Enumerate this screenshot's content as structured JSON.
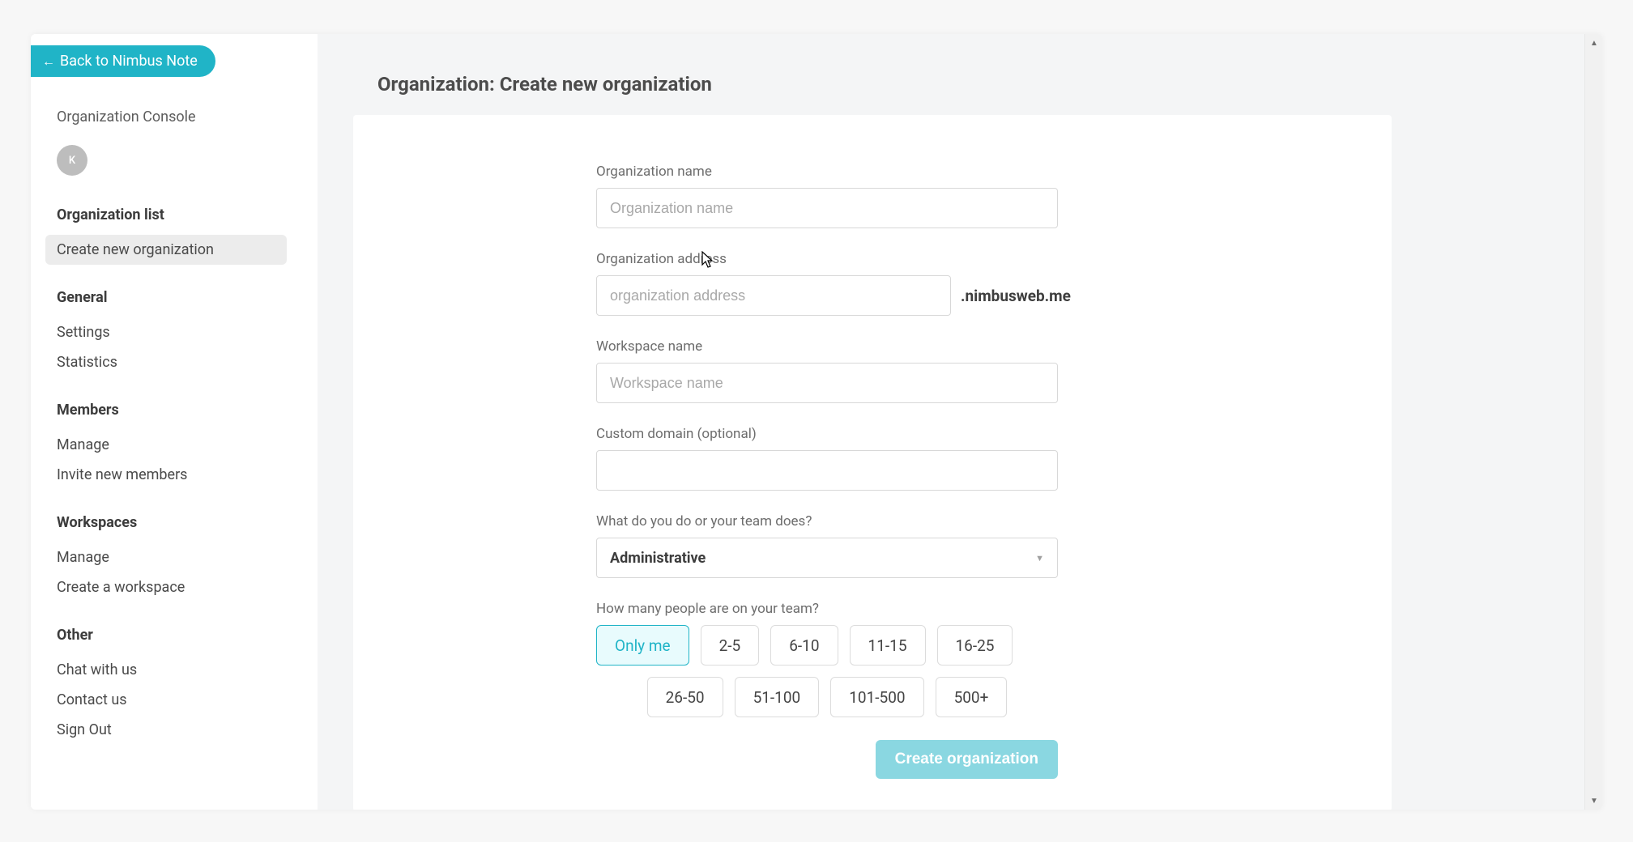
{
  "back_button_label": "Back to Nimbus Note",
  "sidebar": {
    "console_label": "Organization Console",
    "avatar_initial": "K",
    "groups": [
      {
        "heading": "Organization list",
        "items": [
          {
            "label": "Create new organization",
            "active": true
          }
        ]
      },
      {
        "heading": "General",
        "items": [
          {
            "label": "Settings"
          },
          {
            "label": "Statistics"
          }
        ]
      },
      {
        "heading": "Members",
        "items": [
          {
            "label": "Manage"
          },
          {
            "label": "Invite new members"
          }
        ]
      },
      {
        "heading": "Workspaces",
        "items": [
          {
            "label": "Manage"
          },
          {
            "label": "Create a workspace"
          }
        ]
      },
      {
        "heading": "Other",
        "items": [
          {
            "label": "Chat with us"
          },
          {
            "label": "Contact us"
          },
          {
            "label": "Sign Out"
          }
        ]
      }
    ]
  },
  "page_title": "Organization: Create new organization",
  "form": {
    "org_name_label": "Organization name",
    "org_name_placeholder": "Organization name",
    "org_addr_label": "Organization address",
    "org_addr_placeholder": "organization address",
    "domain_suffix": ".nimbusweb.me",
    "workspace_label": "Workspace name",
    "workspace_placeholder": "Workspace name",
    "custom_domain_label": "Custom domain (optional)",
    "team_does_label": "What do you do or your team does?",
    "team_does_value": "Administrative",
    "team_size_label": "How many people are on your team?",
    "team_size_options_row1": [
      "Only me",
      "2-5",
      "6-10",
      "11-15",
      "16-25"
    ],
    "team_size_options_row2": [
      "26-50",
      "51-100",
      "101-500",
      "500+"
    ],
    "team_size_selected": "Only me",
    "submit_label": "Create organization"
  }
}
